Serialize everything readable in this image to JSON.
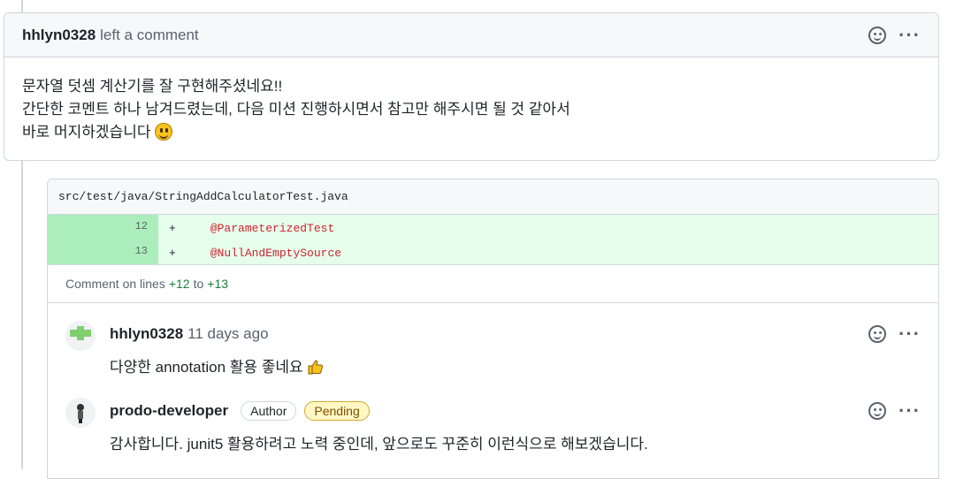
{
  "comment": {
    "author": "hhlyn0328",
    "action": "left a comment",
    "lines": [
      "문자열 덧셈 계산기를 잘 구현해주셨네요!!",
      "간단한 코멘트 하나 남겨드렸는데, 다음 미션 진행하시면서 참고만 해주시면 될 것 같아서",
      "바로 머지하겠습니다"
    ]
  },
  "review": {
    "file_path": "src/test/java/StringAddCalculatorTest.java",
    "diff": [
      {
        "num": "12",
        "sign": "+",
        "code": "@ParameterizedTest"
      },
      {
        "num": "13",
        "sign": "+",
        "code": "@NullAndEmptySource"
      }
    ],
    "lines_note": {
      "prefix": "Comment on lines",
      "from": "+12",
      "to_word": "to",
      "to": "+13"
    },
    "replies": [
      {
        "author": "hhlyn0328",
        "time": "11 days ago",
        "text": "다양한 annotation 활용 좋네요"
      },
      {
        "author": "prodo-developer",
        "badge_author": "Author",
        "badge_pending": "Pending",
        "text": "감사합니다. junit5 활용하려고 노력 중인데, 앞으로도 꾸준히 이런식으로 해보겠습니다."
      }
    ]
  },
  "colors": {
    "added_bg": "#e6ffec",
    "added_num_bg": "#aceebb",
    "annotation": "#cf222e",
    "pending_bg": "#fff8c5"
  }
}
